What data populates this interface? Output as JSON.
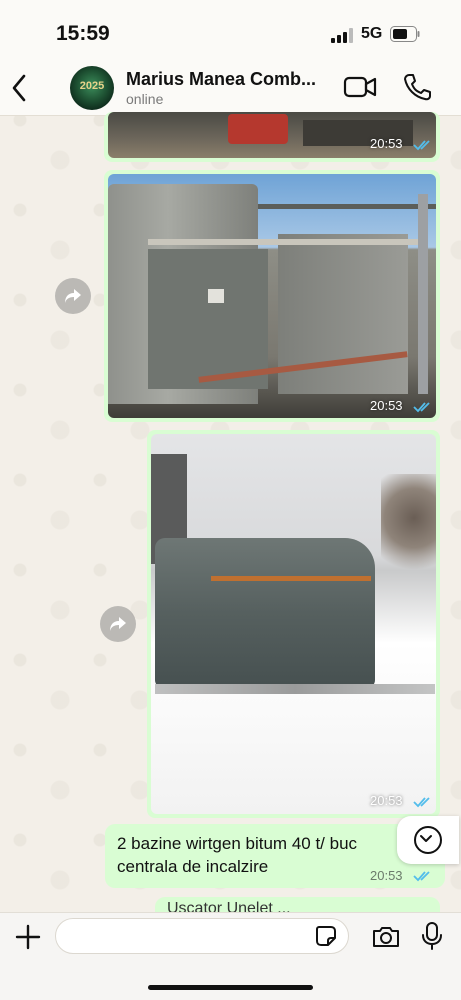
{
  "status_bar": {
    "time": "15:59",
    "network": "5G"
  },
  "header": {
    "contact_name": "Marius Manea Comb...",
    "contact_status": "online",
    "avatar_text": "2025"
  },
  "messages": [
    {
      "type": "image",
      "time": "20:53",
      "subject": "industrial equipment partial"
    },
    {
      "type": "image",
      "time": "20:53",
      "subject": "bitumen tanks with pipes"
    },
    {
      "type": "image",
      "time": "20:53",
      "subject": "tank in snow"
    },
    {
      "type": "text",
      "lines": [
        "2 bazine wirtgen bitum 40 t/ buc",
        "centrala de incalzire"
      ],
      "time": "20:53"
    }
  ],
  "partial_message": "Uscator Unelet ...",
  "input": {
    "placeholder": ""
  },
  "colors": {
    "bubble": "#d9fdd3",
    "tick_blue": "#53bdeb",
    "wallpaper": "#efeae2"
  },
  "icons": [
    "back-icon",
    "video-call-icon",
    "phone-icon",
    "forward-icon",
    "double-tick-icon",
    "chevron-down-icon",
    "plus-icon",
    "sticker-icon",
    "camera-icon",
    "mic-icon"
  ]
}
